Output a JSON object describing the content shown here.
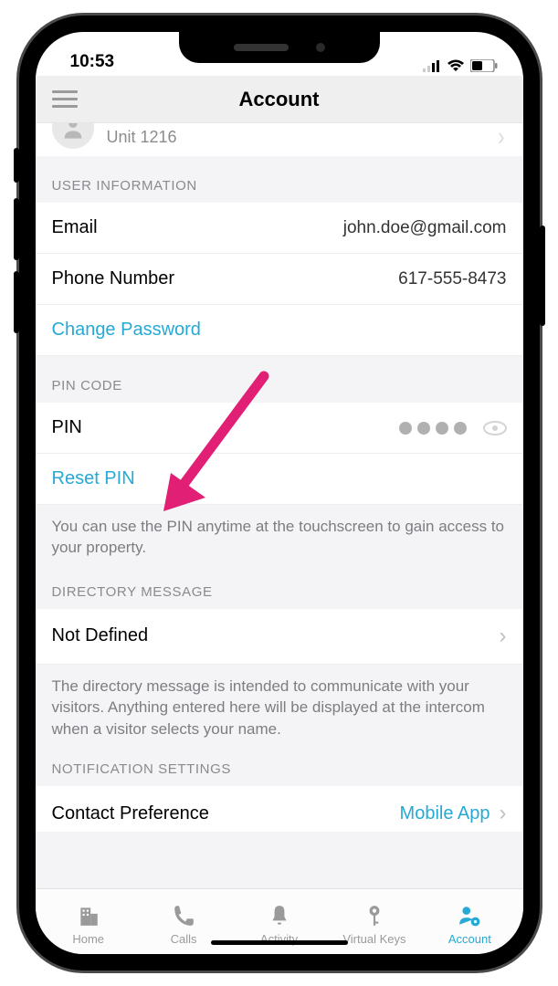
{
  "status": {
    "time": "10:53"
  },
  "header": {
    "title": "Account"
  },
  "profile": {
    "subline": "Unit 1216"
  },
  "sections": {
    "userInfo": {
      "title": "USER INFORMATION",
      "emailLabel": "Email",
      "emailValue": "john.doe@gmail.com",
      "phoneLabel": "Phone Number",
      "phoneValue": "617-555-8473",
      "changePasswordLabel": "Change Password"
    },
    "pin": {
      "title": "PIN CODE",
      "rowLabel": "PIN",
      "resetLabel": "Reset PIN",
      "footnote": "You can use the PIN anytime at the touchscreen to gain access to your property."
    },
    "directory": {
      "title": "DIRECTORY MESSAGE",
      "value": "Not Defined",
      "footnote": "The directory message is intended to communicate with your visitors. Anything entered here will be displayed at the intercom when a visitor selects your name."
    },
    "notifications": {
      "title": "NOTIFICATION SETTINGS",
      "contactPrefLabel": "Contact Preference",
      "contactPrefValue": "Mobile App"
    }
  },
  "tabs": {
    "home": "Home",
    "calls": "Calls",
    "activity": "Activity",
    "virtualKeys": "Virtual Keys",
    "account": "Account"
  },
  "colors": {
    "accent": "#26a9d5",
    "annotation": "#e11f74"
  }
}
